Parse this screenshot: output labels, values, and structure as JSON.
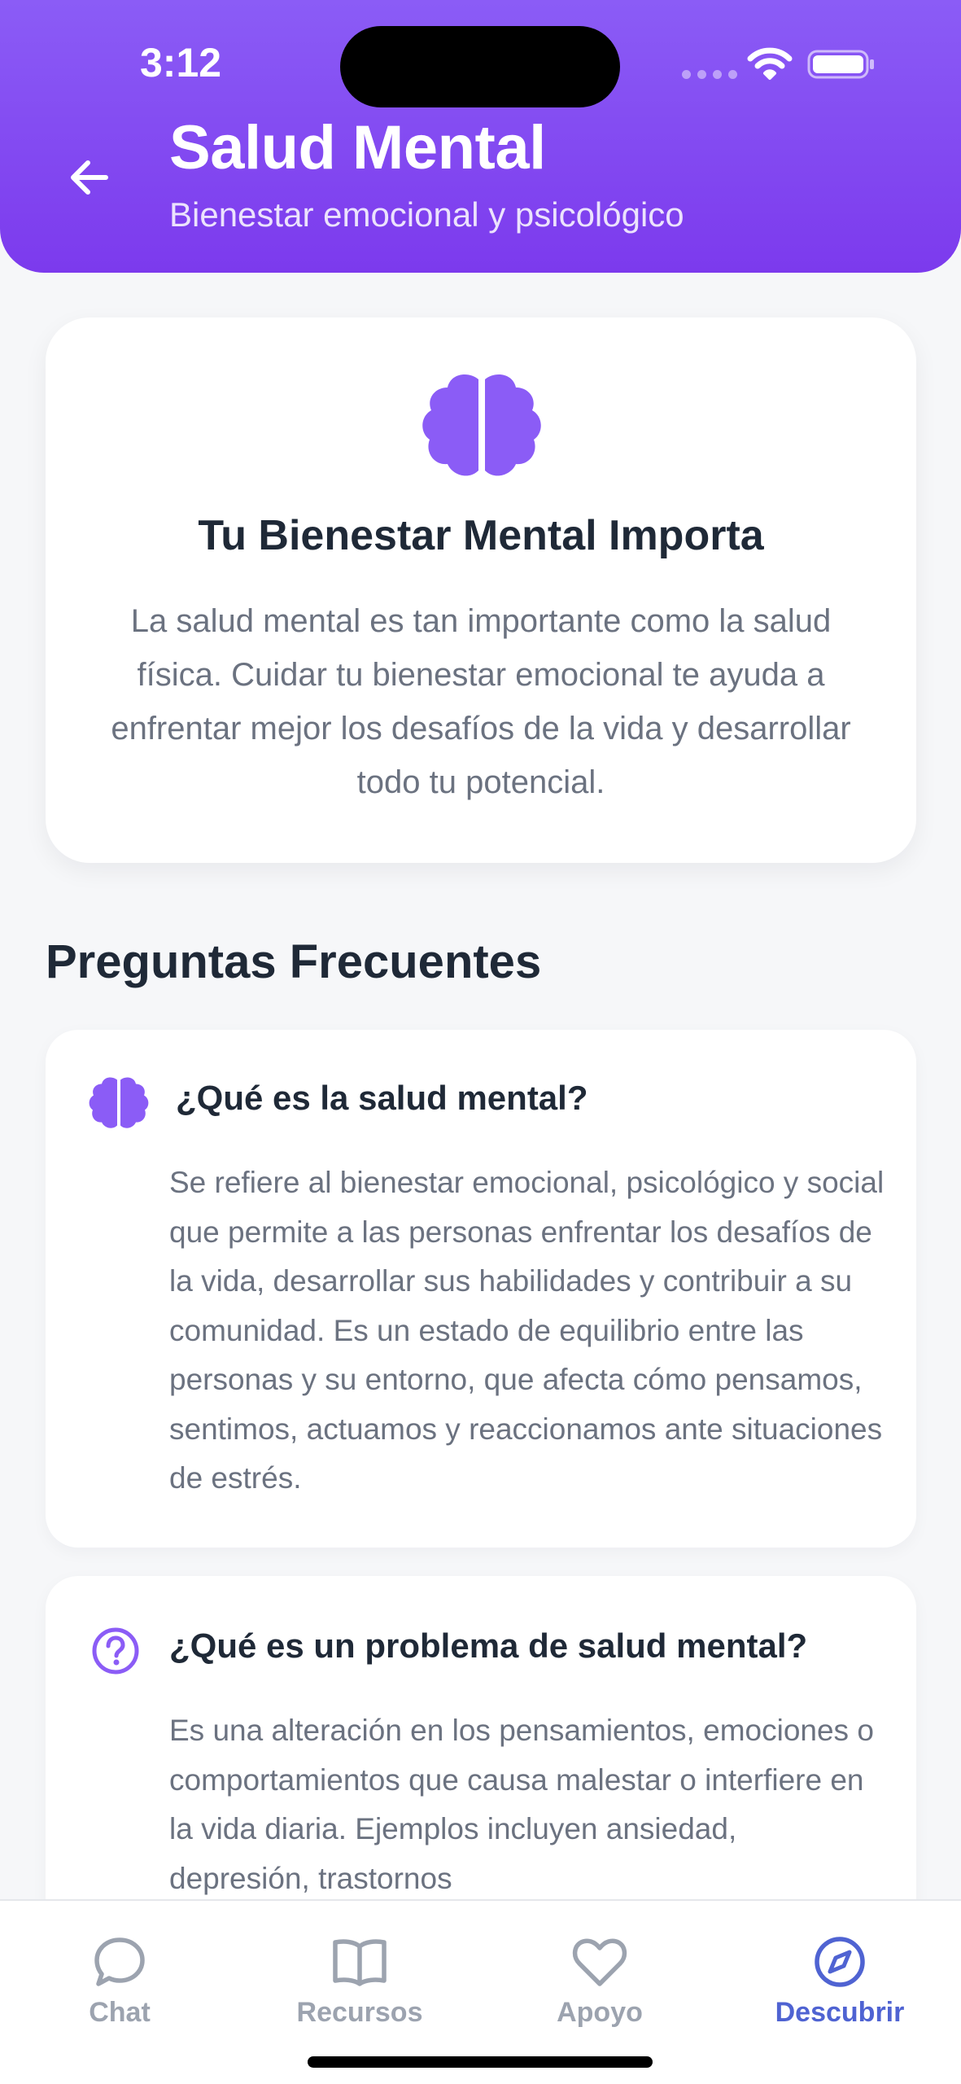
{
  "status_bar": {
    "time": "3:12"
  },
  "header": {
    "title": "Salud Mental",
    "subtitle": "Bienestar emocional y psicológico",
    "back_icon": "arrow-left-icon"
  },
  "intro": {
    "icon": "brain-icon",
    "title": "Tu Bienestar Mental Importa",
    "text": "La salud mental es tan importante como la salud física. Cuidar tu bienestar emocional te ayuda a enfrentar mejor los desafíos de la vida y desarrollar todo tu potencial."
  },
  "faq": {
    "section_title": "Preguntas Frecuentes",
    "items": [
      {
        "icon": "brain-icon",
        "question": "¿Qué es la salud mental?",
        "answer": "Se refiere al bienestar emocional, psicológico y social que permite a las personas enfrentar los desafíos de la vida, desarrollar sus habilidades y contribuir a su comunidad. Es un estado de equilibrio entre las personas y su entorno, que afecta cómo pensamos, sentimos, actuamos y reaccionamos ante situaciones de estrés."
      },
      {
        "icon": "question-circle-icon",
        "question": "¿Qué es un problema de salud mental?",
        "answer": "Es una alteración en los pensamientos, emociones o comportamientos que causa malestar o interfiere en la vida diaria. Ejemplos incluyen ansiedad, depresión, trastornos"
      }
    ]
  },
  "bottom_nav": {
    "items": [
      {
        "label": "Chat",
        "icon": "chat-bubble-icon",
        "active": false
      },
      {
        "label": "Recursos",
        "icon": "book-icon",
        "active": false
      },
      {
        "label": "Apoyo",
        "icon": "heart-icon",
        "active": false
      },
      {
        "label": "Descubrir",
        "icon": "compass-icon",
        "active": true
      }
    ]
  },
  "colors": {
    "header_top": "#8b5cf6",
    "header_bottom": "#7c3aed",
    "accent_purple": "#8b5cf6",
    "nav_active": "#4f63d2",
    "nav_inactive": "#9ca3af"
  }
}
